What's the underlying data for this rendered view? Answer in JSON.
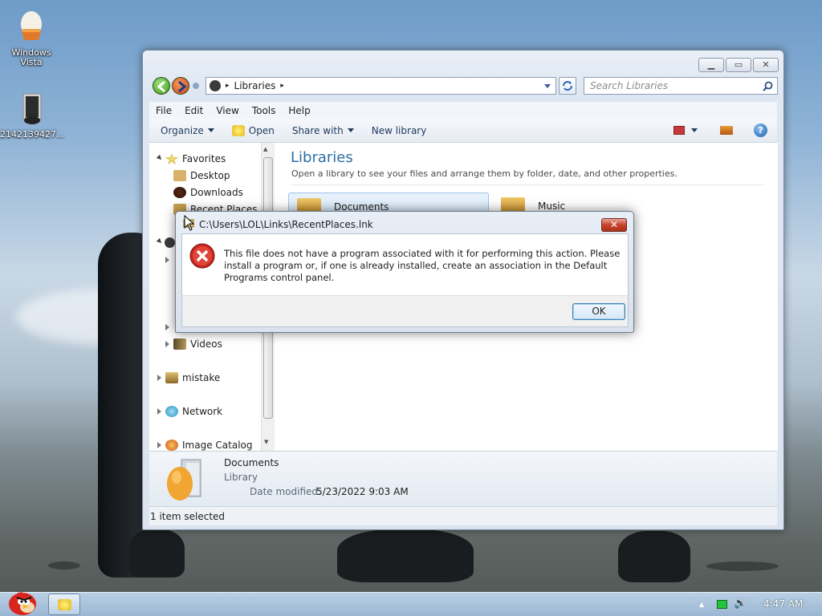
{
  "desktop": {
    "icons": [
      {
        "label": "Windows Vista",
        "icon": "windows-vista-egg-icon"
      },
      {
        "label": "2142139427...",
        "icon": "file-thumbnail-icon"
      }
    ]
  },
  "explorer": {
    "address": {
      "root": "Libraries"
    },
    "search": {
      "placeholder": "Search Libraries"
    },
    "menu": [
      "File",
      "Edit",
      "View",
      "Tools",
      "Help"
    ],
    "toolbar": {
      "organize": "Organize",
      "open": "Open",
      "share_with": "Share with",
      "new_library": "New library"
    },
    "nav": {
      "favorites": "Favorites",
      "desktop": "Desktop",
      "downloads": "Downloads",
      "recent_places": "Recent Places",
      "videos": "Videos",
      "mistake": "mistake",
      "network": "Network",
      "image_catalog": "Image Catalog"
    },
    "content": {
      "title": "Libraries",
      "subtitle": "Open a library to see your files and arrange them by folder, date, and other properties.",
      "items": [
        "Documents",
        "Music"
      ]
    },
    "details": {
      "name": "Documents",
      "type": "Library",
      "date_label": "Date modified:",
      "date_value": "5/23/2022 9:03 AM"
    },
    "status": "1 item selected"
  },
  "dialog": {
    "title": "C:\\Users\\LOL\\Links\\RecentPlaces.lnk",
    "message": "This file does not have a program associated with it for performing this action. Please install a program or, if one is already installed, create an association in the Default Programs control panel.",
    "ok": "OK",
    "icon": "error-icon"
  },
  "taskbar": {
    "clock": "4:47 AM"
  },
  "colors": {
    "accent": "#1e5aa8",
    "title_text": "#2b6ea5",
    "error_red": "#c8281e"
  }
}
